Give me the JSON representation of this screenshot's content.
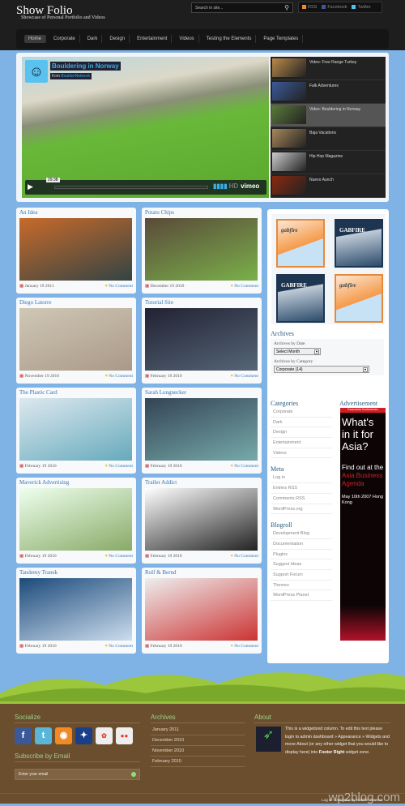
{
  "header": {
    "title": "Show Folio",
    "tagline": "Showcase of Personal Portfolio and Videos",
    "search_placeholder": "Search in site...",
    "social": [
      {
        "label": "RSS",
        "color": "#f08a24"
      },
      {
        "label": "Facebook",
        "color": "#3b5998"
      },
      {
        "label": "Twitter",
        "color": "#4fc3e8"
      }
    ]
  },
  "nav": {
    "items": [
      "Home",
      "Corporate",
      "Dark",
      "Design",
      "Entertainment",
      "Videos",
      "Testing the Elements",
      "Page Templates"
    ],
    "active": "Home"
  },
  "video": {
    "title": "Bouldering in Norway",
    "from_label": "from",
    "author": "BoulderNetwork",
    "time": "29:38",
    "brand": "vimeo",
    "hd": "HD"
  },
  "playlist": [
    "Video: Free Range Turkey",
    "Falk Adventures",
    "Video: Bouldering in Norway",
    "Baja Vacations",
    "Hip Hop Magazine",
    "Nuevo Aunch"
  ],
  "playlist_active": 2,
  "posts": [
    {
      "title": "An Idea",
      "date": "January 19 2011",
      "comments": "No Comment"
    },
    {
      "title": "Potato Chips",
      "date": "December 19 2010",
      "comments": "No Comment"
    },
    {
      "title": "Diego Latorre",
      "date": "November 19 2010",
      "comments": "No Comment"
    },
    {
      "title": "Tutorial Site",
      "date": "February 19 2010",
      "comments": "No Comment"
    },
    {
      "title": "The Plastic Card",
      "date": "February 19 2010",
      "comments": "No Comment"
    },
    {
      "title": "Sarah Longnecker",
      "date": "February 19 2010",
      "comments": "No Comment"
    },
    {
      "title": "Maverick Advertising",
      "date": "February 19 2010",
      "comments": "No Comment"
    },
    {
      "title": "Trailer Addict",
      "date": "February 19 2010",
      "comments": "No Comment"
    },
    {
      "title": "Tandemy Tranek",
      "date": "February 19 2010",
      "comments": "No Comment"
    },
    {
      "title": "Rolf & Bernd",
      "date": "February 19 2010",
      "comments": "No Comment"
    }
  ],
  "sidebar": {
    "ads": [
      "gabfire",
      "GABFIRE",
      "GABFIRE",
      "gabfire"
    ],
    "archives": {
      "title": "Archives",
      "by_date_label": "Archives by Date",
      "by_date_value": "Select Month",
      "by_category_label": "Archives by Category",
      "by_category_value": "Corporate  (14)"
    },
    "categories": {
      "title": "Categories",
      "items": [
        "Corporate",
        "Dark",
        "Design",
        "Entertainment",
        "Videos"
      ]
    },
    "meta": {
      "title": "Meta",
      "items": [
        "Log in",
        "Entries RSS",
        "Comments RSS",
        "WordPress.org"
      ]
    },
    "blogroll": {
      "title": "Blogroll",
      "items": [
        "Development Blog",
        "Documentation",
        "Plugins",
        "Suggest Ideas",
        "Support Forum",
        "Themes",
        "WordPress Planet"
      ]
    },
    "advertisement": {
      "title": "Advertisement",
      "header": "Economist Conferences",
      "line1": "What's in it for Asia?",
      "line2": "Find out at the",
      "line3": "Asia Business Agenda",
      "line4": "May 10th 2007 Hong Kong"
    }
  },
  "footer": {
    "socialize_title": "Socialize",
    "social_icons": [
      "facebook",
      "twitter",
      "rss",
      "myspace",
      "picasa",
      "flickr"
    ],
    "subscribe_title": "Subscribe by Email",
    "email_placeholder": "Enter your email",
    "archives_title": "Archives",
    "archives": [
      "January 2011",
      "December 2010",
      "November 2010",
      "February 2010"
    ],
    "about_title": "About",
    "about_text": "This is a widgetized column. To edit this text please login to admin dashboard » Appearance » Widgets and move About (or any other widget that you would like to display here) into",
    "about_bold": "Footer Right",
    "about_tail": "widget zone.",
    "links": "Log in · Designed by Gabfire Themes",
    "watermark": "wp2blog.com"
  }
}
